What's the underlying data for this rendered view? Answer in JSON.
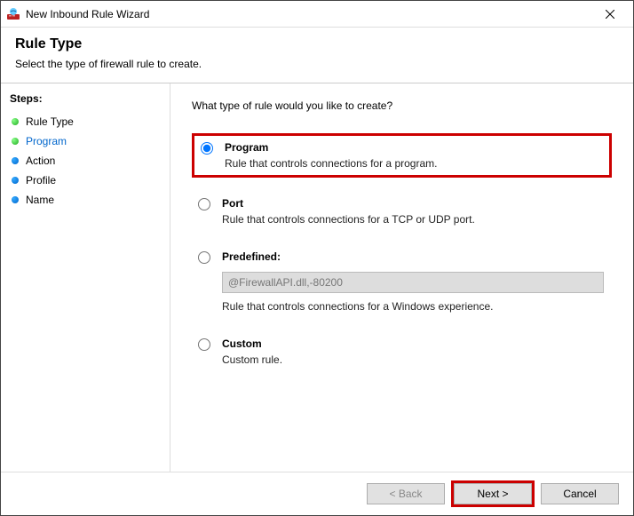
{
  "titlebar": {
    "title": "New Inbound Rule Wizard"
  },
  "header": {
    "heading": "Rule Type",
    "subheading": "Select the type of firewall rule to create."
  },
  "sidebar": {
    "steps_label": "Steps:",
    "items": [
      {
        "label": "Rule Type"
      },
      {
        "label": "Program"
      },
      {
        "label": "Action"
      },
      {
        "label": "Profile"
      },
      {
        "label": "Name"
      }
    ]
  },
  "content": {
    "question": "What type of rule would you like to create?",
    "options": {
      "program": {
        "label": "Program",
        "desc": "Rule that controls connections for a program."
      },
      "port": {
        "label": "Port",
        "desc": "Rule that controls connections for a TCP or UDP port."
      },
      "predefined": {
        "label": "Predefined:",
        "select_value": "@FirewallAPI.dll,-80200",
        "desc": "Rule that controls connections for a Windows experience."
      },
      "custom": {
        "label": "Custom",
        "desc": "Custom rule."
      }
    }
  },
  "footer": {
    "back": "< Back",
    "next": "Next >",
    "cancel": "Cancel"
  }
}
